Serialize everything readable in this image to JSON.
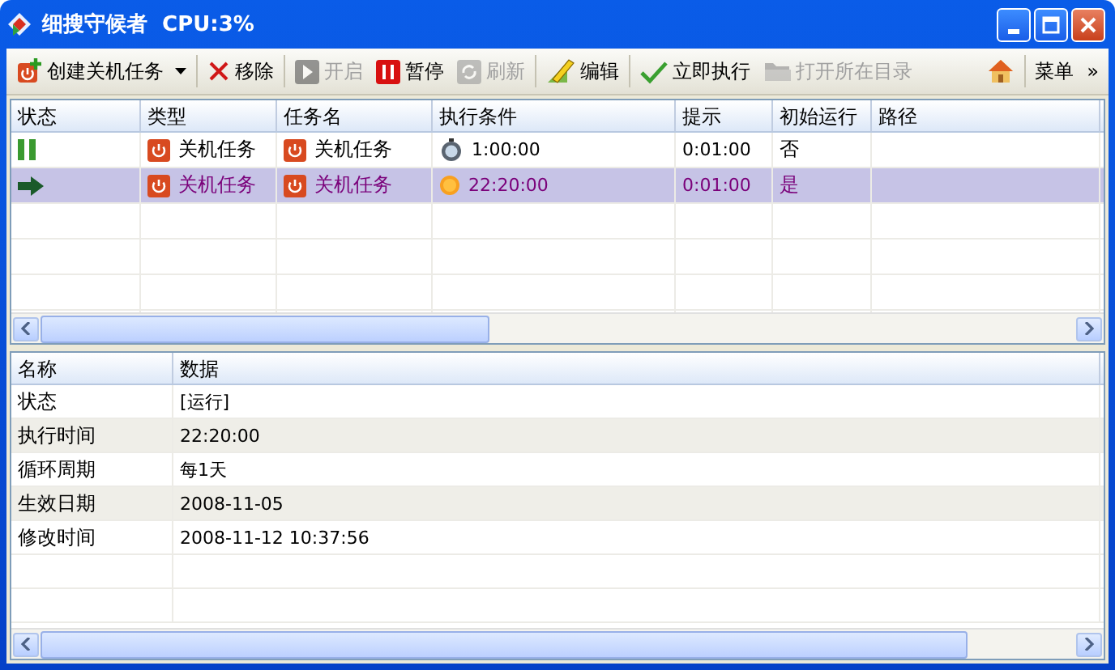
{
  "window": {
    "title": "细搜守候者  CPU:3%"
  },
  "toolbar": [
    {
      "kind": "create",
      "label": "创建关机任务",
      "disabled": false,
      "dropdown": true
    },
    {
      "kind": "remove",
      "label": "移除",
      "disabled": false,
      "dropdown": false
    },
    {
      "kind": "start",
      "label": "开启",
      "disabled": true,
      "dropdown": false
    },
    {
      "kind": "pause",
      "label": "暂停",
      "disabled": false,
      "dropdown": false
    },
    {
      "kind": "refresh",
      "label": "刷新",
      "disabled": true,
      "dropdown": false
    },
    {
      "kind": "edit",
      "label": "编辑",
      "disabled": false,
      "dropdown": false
    },
    {
      "kind": "execute",
      "label": "立即执行",
      "disabled": false,
      "dropdown": false
    },
    {
      "kind": "folder",
      "label": "打开所在目录",
      "disabled": true,
      "dropdown": false
    },
    {
      "kind": "home",
      "disabled": false,
      "dropdown": false
    },
    {
      "kind": "menu",
      "label": "菜单",
      "disabled": false,
      "dropdown": false
    },
    {
      "kind": "more",
      "label": "»",
      "disabled": false,
      "dropdown": false
    }
  ],
  "tasks": {
    "columns": [
      "状态",
      "类型",
      "任务名",
      "执行条件",
      "提示",
      "初始运行",
      "路径"
    ],
    "rows": [
      {
        "running": false,
        "type": "关机任务",
        "name": "关机任务",
        "kind": "timer",
        "condition": "1:00:00",
        "hint": "0:01:00",
        "initial": "否",
        "selected": false
      },
      {
        "running": true,
        "type": "关机任务",
        "name": "关机任务",
        "kind": "clock",
        "condition": "22:20:00",
        "hint": "0:01:00",
        "initial": "是",
        "selected": true
      }
    ]
  },
  "details": {
    "columns": [
      "名称",
      "数据"
    ],
    "rows": [
      {
        "name": "状态",
        "value": "[运行]"
      },
      {
        "name": "执行时间",
        "value": "22:20:00"
      },
      {
        "name": "循环周期",
        "value": "每1天"
      },
      {
        "name": "生效日期",
        "value": "2008-11-05"
      },
      {
        "name": "修改时间",
        "value": "2008-11-12 10:37:56"
      }
    ]
  }
}
